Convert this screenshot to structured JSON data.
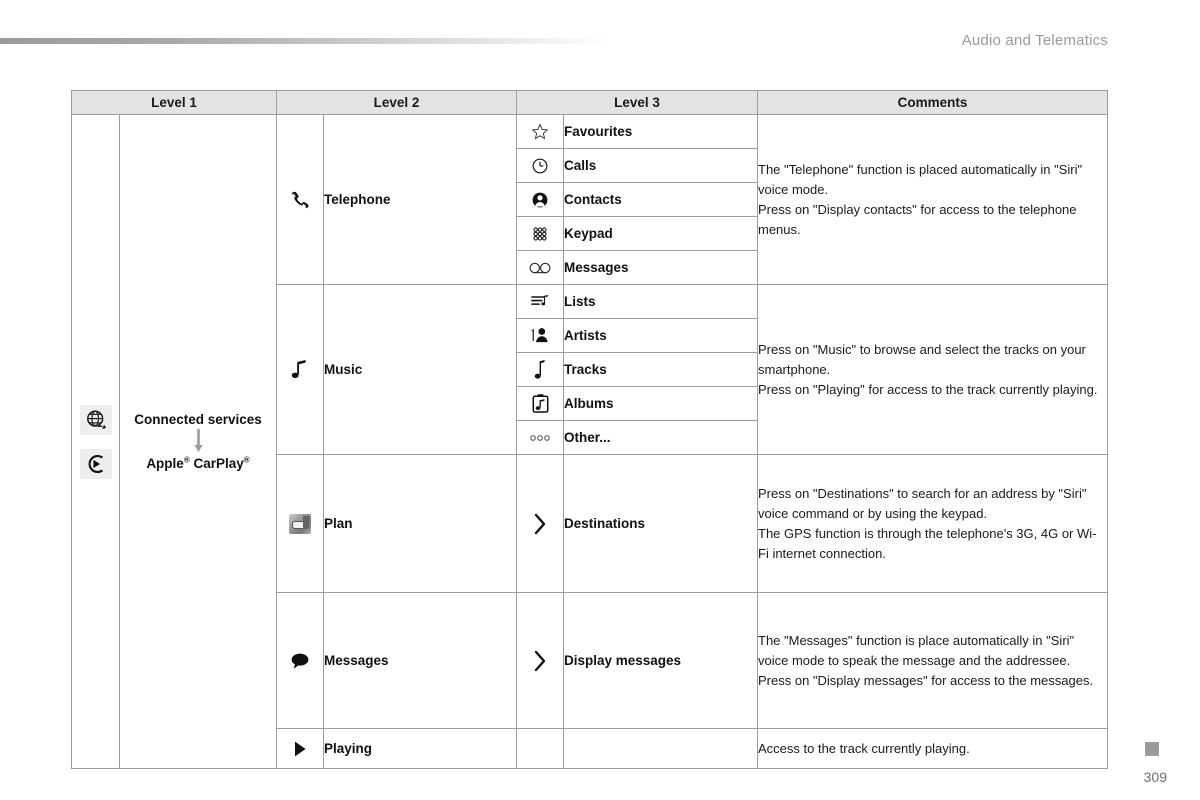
{
  "header": {
    "title": "Audio and Telematics"
  },
  "footer": {
    "page_number": "309"
  },
  "table": {
    "columns": [
      "Level 1",
      "Level 2",
      "Level 3",
      "Comments"
    ],
    "level1": {
      "icons": [
        "globe-connected-services-icon",
        "apple-carplay-icon"
      ],
      "primary_label": "Connected services",
      "arrow": "down-arrow",
      "secondary_label_parts": {
        "apple": "Apple",
        "sup1": "®",
        "carplay": " CarPlay",
        "sup2": "®"
      },
      "secondary_label": "Apple® CarPlay®"
    },
    "groups": [
      {
        "icon": "telephone-handset-icon",
        "label": "Telephone",
        "level3": [
          {
            "icon": "star-icon",
            "label": "Favourites"
          },
          {
            "icon": "clock-icon",
            "label": "Calls"
          },
          {
            "icon": "contact-person-icon",
            "label": "Contacts"
          },
          {
            "icon": "keypad-dots-icon",
            "label": "Keypad"
          },
          {
            "icon": "voicemail-icon",
            "label": "Messages"
          }
        ],
        "comment_lines": [
          "The \"Telephone\" function is placed automatically in \"Siri\" voice mode.",
          "Press on \"Display contacts\" for access to the telephone menus."
        ]
      },
      {
        "icon": "music-note-icon",
        "label": "Music",
        "level3": [
          {
            "icon": "playlist-icon",
            "label": "Lists"
          },
          {
            "icon": "artist-icon",
            "label": "Artists"
          },
          {
            "icon": "single-note-icon",
            "label": "Tracks"
          },
          {
            "icon": "album-icon",
            "label": "Albums"
          },
          {
            "icon": "ellipsis-icon",
            "label": "Other..."
          }
        ],
        "comment_lines": [
          "Press on \"Music\" to browse and select the tracks on your smartphone.",
          "Press on \"Playing\" for access to the track currently playing."
        ]
      },
      {
        "icon": "map-plan-icon",
        "label": "Plan",
        "level3": [
          {
            "icon": "chevron-right-icon",
            "label": "Destinations"
          }
        ],
        "comment_lines": [
          "Press on \"Destinations\" to search for an address by \"Siri\" voice command or by using the keypad.",
          "The GPS function is through the telephone's 3G, 4G or Wi-Fi internet connection."
        ]
      },
      {
        "icon": "speech-bubble-icon",
        "label": "Messages",
        "level3": [
          {
            "icon": "chevron-right-icon",
            "label": "Display messages"
          }
        ],
        "comment_lines": [
          "The \"Messages\" function is place automatically in \"Siri\" voice mode to speak the message and the addressee.",
          "Press on \"Display messages\" for access to the messages."
        ]
      },
      {
        "icon": "play-triangle-icon",
        "label": "Playing",
        "level3": [],
        "comment_lines": [
          "Access to the track currently playing."
        ]
      }
    ]
  }
}
